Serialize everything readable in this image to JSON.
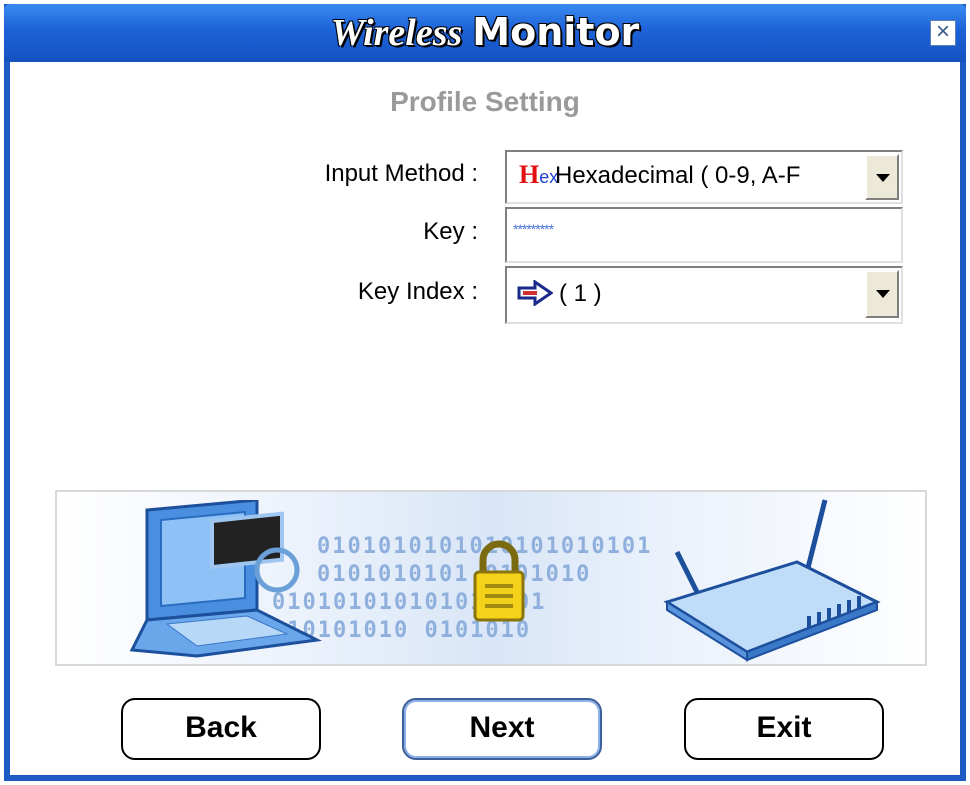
{
  "window": {
    "title_italic": "Wireless",
    "title_bold": "Monitor",
    "close_label": "×"
  },
  "heading": "Profile Setting",
  "form": {
    "input_method_label": "Input Method :",
    "input_method_badge_h": "H",
    "input_method_badge_ex": "ex",
    "input_method_value": "Hexadecimal ( 0-9, A-F",
    "key_label": "Key :",
    "key_value": "*********",
    "key_index_label": "Key Index :",
    "key_index_value": "( 1 )"
  },
  "banner": {
    "binary_rows": [
      "0101010101010101010101",
      "0101010101 0101010",
      "010101010101010101",
      "010101010 0101010"
    ]
  },
  "buttons": {
    "back": "Back",
    "next": "Next",
    "exit": "Exit"
  },
  "colors": {
    "titlebar": "#1c62d8",
    "heading": "#9a9a9a",
    "hex_red": "#e01010",
    "hex_blue": "#2040d0"
  },
  "icons": {
    "close": "close-icon",
    "dropdown": "chevron-down-icon",
    "key_index": "arrow-right-icon",
    "laptop": "laptop-icon",
    "lock": "lock-icon",
    "router": "router-icon"
  }
}
